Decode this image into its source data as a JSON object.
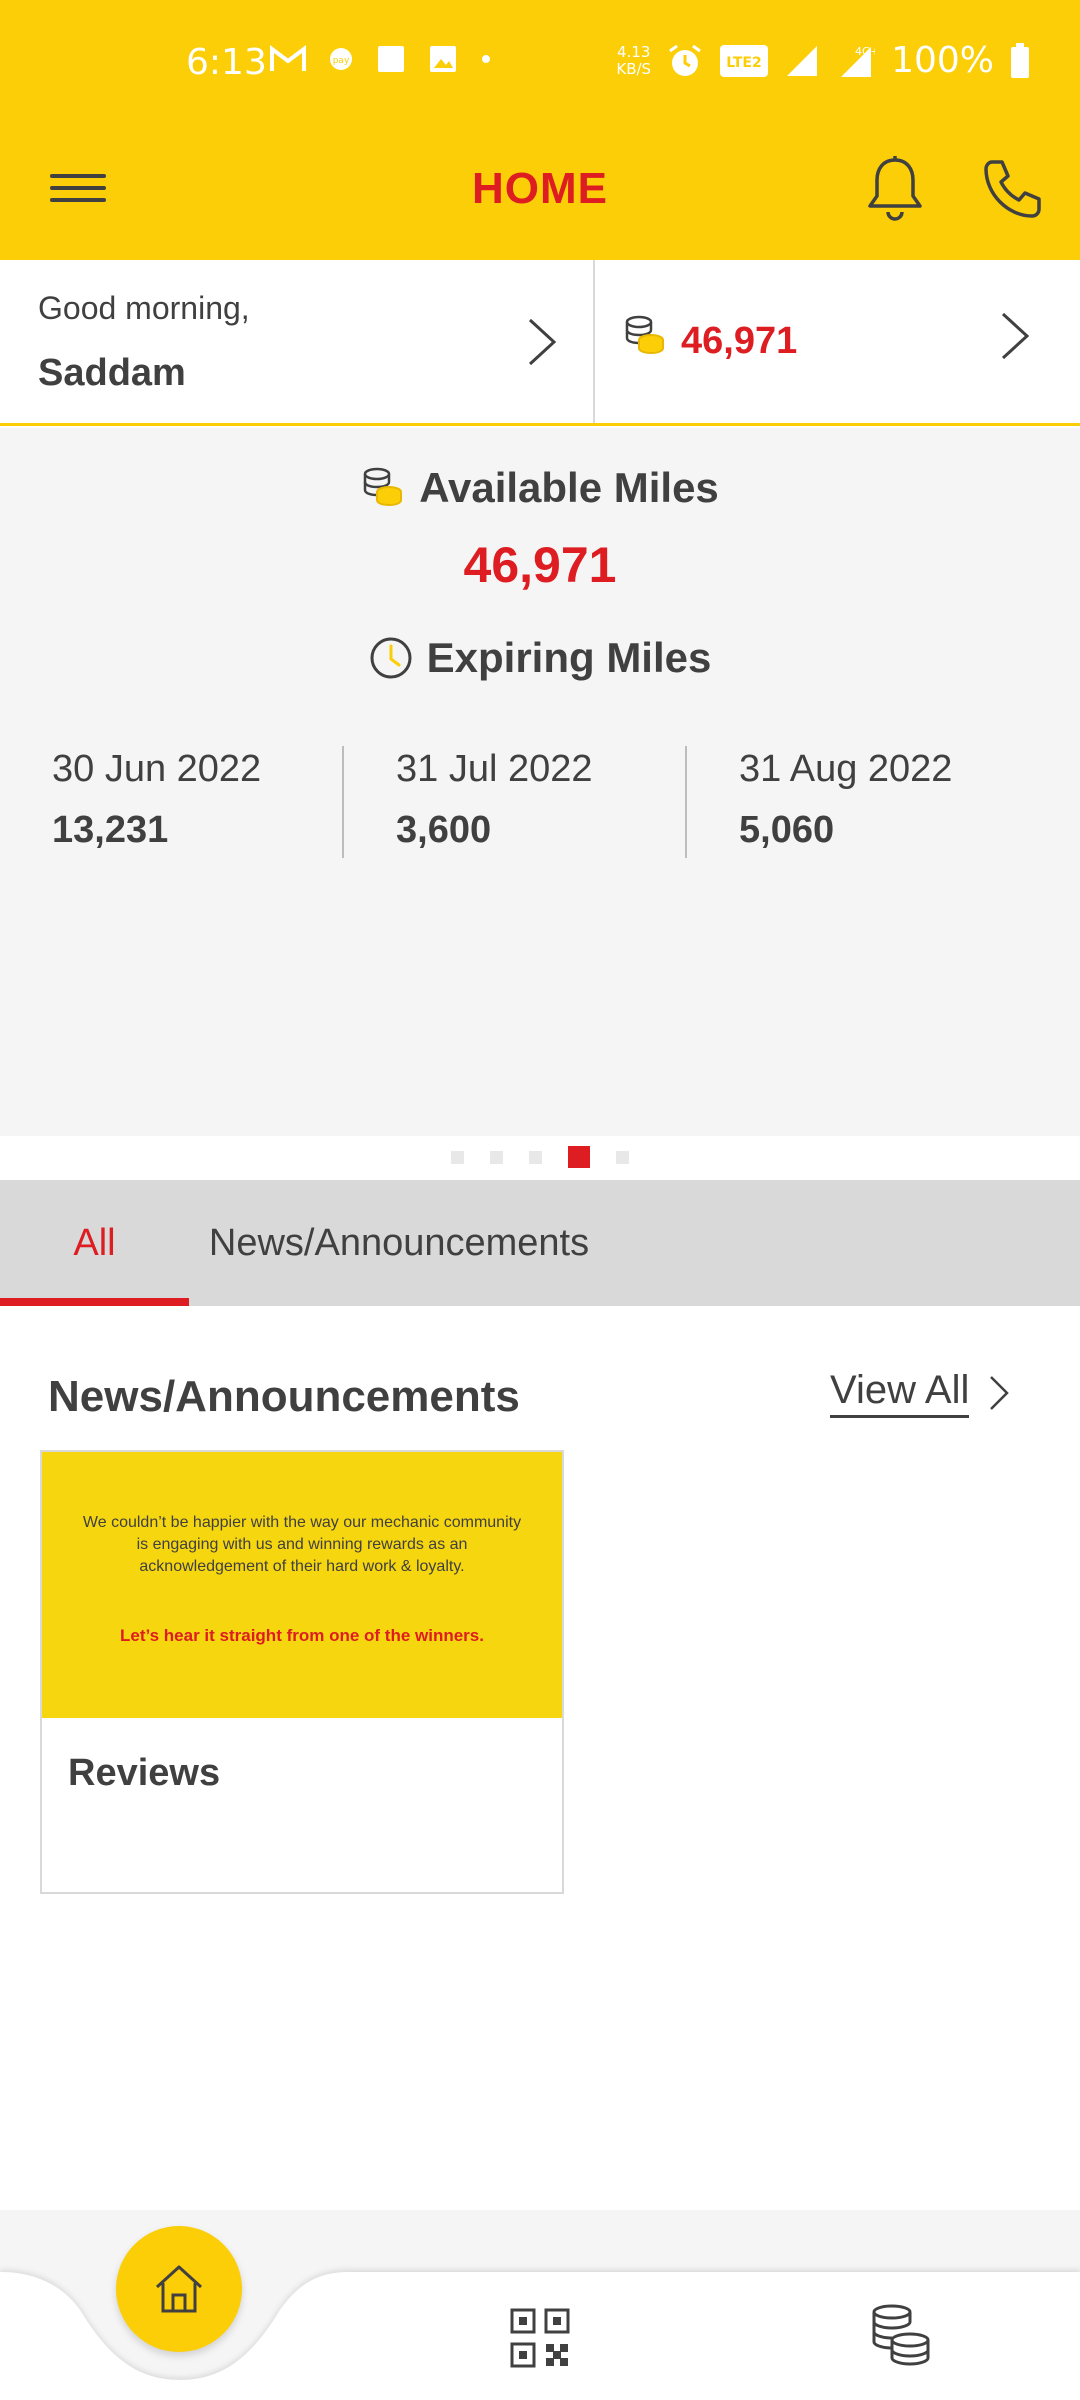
{
  "status_bar": {
    "time": "6:13",
    "net_speed_top": "4.13",
    "net_speed_bottom": "KB/S",
    "volte_label": "Vo LTE 2",
    "network_type": "4G+",
    "battery": "100%",
    "icons": [
      "gmail-icon",
      "pay-icon",
      "square-icon",
      "gallery-icon",
      "dot-icon",
      "alarm-icon",
      "volte-icon",
      "signal-icon",
      "signal-4g-icon",
      "battery-icon"
    ]
  },
  "header": {
    "title": "HOME",
    "menu_icon": "hamburger-menu-icon",
    "notification_icon": "bell-icon",
    "call_icon": "phone-icon"
  },
  "greeting": {
    "text": "Good morning,",
    "name": "Saddam",
    "miles_value": "46,971"
  },
  "summary": {
    "available_label": "Available Miles",
    "available_value": "46,971",
    "expiring_label": "Expiring Miles",
    "expiring": [
      {
        "date": "30 Jun 2022",
        "amount": "13,231"
      },
      {
        "date": "31 Jul 2022",
        "amount": "3,600"
      },
      {
        "date": "31 Aug 2022",
        "amount": "5,060"
      }
    ],
    "carousel_pages": 5,
    "carousel_active_page": 4
  },
  "tabs": [
    {
      "label": "All",
      "active": true
    },
    {
      "label": "News/Announcements",
      "active": false
    }
  ],
  "news": {
    "section_title": "News/Announcements",
    "view_all_label": "View All",
    "cards": [
      {
        "image_text": "We couldn’t be happier with the way our mechanic community is engaging with us and winning rewards as an acknowledgement of their hard work & loyalty.",
        "image_cta": "Let’s hear it straight from one of the winners.",
        "title": "Reviews"
      }
    ]
  },
  "bottom_nav": {
    "items": [
      "home-icon",
      "qr-code-icon",
      "coins-icon"
    ],
    "active": "home-icon"
  },
  "colors": {
    "brand_yellow": "#fbce07",
    "brand_red": "#dd1d21",
    "text_dark": "#404040",
    "panel_bg": "#f5f5f5",
    "tab_bg": "#d9d9d9"
  }
}
